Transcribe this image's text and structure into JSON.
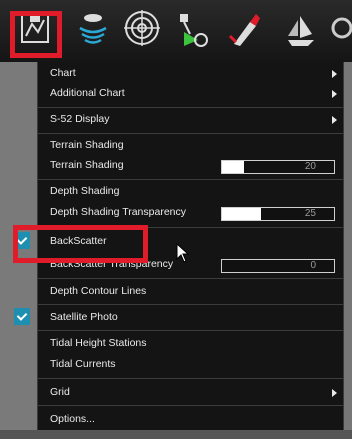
{
  "toolbar": {
    "buttons": [
      {
        "icon": "chart-layers-icon"
      },
      {
        "icon": "sonar-icon"
      },
      {
        "icon": "radar-icon"
      },
      {
        "icon": "route-tools-icon"
      },
      {
        "icon": "tide-icon"
      },
      {
        "icon": "vessel-icon"
      }
    ],
    "highlight_color": "#e01b2a"
  },
  "menu": {
    "chart": "Chart",
    "additional_chart": "Additional Chart",
    "s52_display": "S-52 Display",
    "terrain_shading_header": "Terrain Shading",
    "terrain_shading": "Terrain Shading",
    "terrain_shading_value": "20",
    "terrain_shading_fill": 0.2,
    "depth_shading_header": "Depth Shading",
    "depth_shading_transparency": "Depth Shading Transparency",
    "depth_shading_transparency_value": "25",
    "depth_shading_transparency_fill": 0.35,
    "backscatter": "BackScatter",
    "backscatter_transparency": "BackScatter Transparency",
    "backscatter_transparency_value": "0",
    "depth_contour_lines": "Depth Contour Lines",
    "satellite_photo": "Satellite Photo",
    "tidal_height_stations": "Tidal Height Stations",
    "tidal_currents": "Tidal Currents",
    "grid": "Grid",
    "options": "Options...",
    "check_color": "#1e8fb0"
  }
}
